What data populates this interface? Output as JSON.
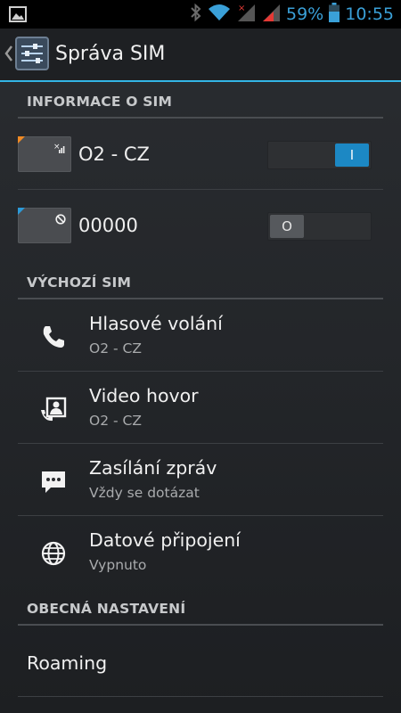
{
  "status_bar": {
    "battery_percent": "59%",
    "time": "10:55",
    "icons": [
      "image-icon",
      "bluetooth-icon",
      "wifi-icon",
      "signal-icon",
      "signal-no-service-icon",
      "battery-icon"
    ]
  },
  "action_bar": {
    "title": "Správa SIM",
    "icon": "sim-settings-icon"
  },
  "sections": {
    "sim_info": "INFORMACE O SIM",
    "default_sim": "VÝCHOZÍ SIM",
    "general": "OBECNÁ NASTAVENÍ"
  },
  "sims": [
    {
      "name": "O2 - CZ",
      "toggle_label": "I",
      "on": true,
      "corner_color": "#f08a24"
    },
    {
      "name": "00000",
      "toggle_label": "O",
      "on": false,
      "corner_color": "#2c9ad8"
    }
  ],
  "default_sim_items": [
    {
      "title": "Hlasové volání",
      "summary": "O2 - CZ",
      "icon": "phone-icon"
    },
    {
      "title": "Video hovor",
      "summary": "O2 - CZ",
      "icon": "video-call-icon"
    },
    {
      "title": "Zasílání zpráv",
      "summary": "Vždy se dotázat",
      "icon": "message-icon"
    },
    {
      "title": "Datové připojení",
      "summary": "Vypnuto",
      "icon": "globe-icon"
    }
  ],
  "general_items": [
    {
      "title": "Roaming"
    }
  ],
  "colors": {
    "accent": "#33b5e5",
    "toggle_on": "#1c88c4"
  }
}
